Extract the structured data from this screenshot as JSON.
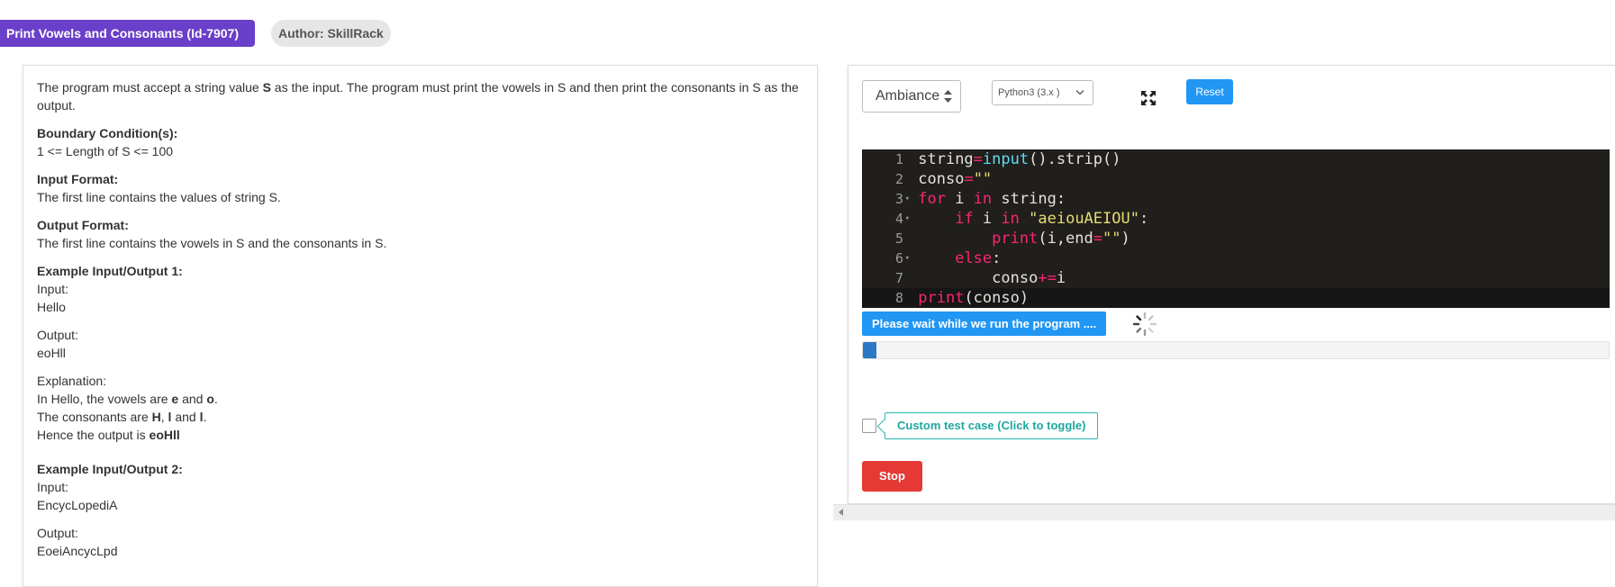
{
  "header": {
    "title": "Print Vowels and Consonants (Id-7907)",
    "author": "Author: SkillRack"
  },
  "problem": {
    "intro_before": "The program must accept a string value ",
    "intro_var": "S",
    "intro_after": " as the input. The program must print the vowels in S and then print the consonants in S as the output.",
    "boundary_heading": "Boundary Condition(s):",
    "boundary_text": "1 <= Length of S <= 100",
    "input_heading": "Input Format:",
    "input_text": "The first line contains the values of string S.",
    "output_heading": "Output Format:",
    "output_text": "The first line contains the vowels in S and the consonants in S.",
    "ex1_heading": "Example Input/Output 1:",
    "ex1_input_label": "Input:",
    "ex1_input": "Hello",
    "ex1_output_label": "Output:",
    "ex1_output": "eoHll",
    "explanation_label": "Explanation:",
    "exp_line1_a": "In Hello, the vowels are ",
    "exp_line1_b": "e",
    "exp_line1_c": " and ",
    "exp_line1_d": "o",
    "exp_line1_e": ".",
    "exp_line2_a": "The consonants are ",
    "exp_line2_b": "H",
    "exp_line2_c": ", ",
    "exp_line2_d": "l",
    "exp_line2_e": " and ",
    "exp_line2_f": "l",
    "exp_line2_g": ".",
    "exp_line3_a": "Hence the output is ",
    "exp_line3_b": "eoHll",
    "ex2_heading": "Example Input/Output 2:",
    "ex2_input_label": "Input:",
    "ex2_input": "EncycLopediA",
    "ex2_output_label": "Output:",
    "ex2_output": "EoeiAncycLpd"
  },
  "editor": {
    "theme": "Ambiance",
    "language": "Python3 (3.x )",
    "reset_label": "Reset",
    "line_numbers": [
      "1",
      "2",
      "3",
      "4",
      "5",
      "6",
      "7",
      "8"
    ],
    "fold_marker": "▾",
    "code": {
      "l1_a": "string",
      "l1_b": "=",
      "l1_c": "input",
      "l1_d": "().strip()",
      "l2_a": "conso",
      "l2_b": "=",
      "l2_c": "\"\"",
      "l3_a": "for",
      "l3_b": " i ",
      "l3_c": "in",
      "l3_d": " string:",
      "l4_indent": "    ",
      "l4_a": "if",
      "l4_b": " i ",
      "l4_c": "in",
      "l4_d": " ",
      "l4_e": "\"aeiouAEIOU\"",
      "l4_f": ":",
      "l5_indent": "        ",
      "l5_a": "print",
      "l5_b": "(i,end",
      "l5_c": "=",
      "l5_d": "\"\"",
      "l5_e": ")",
      "l6_indent": "    ",
      "l6_a": "else",
      "l6_b": ":",
      "l7_indent": "        ",
      "l7_a": "conso",
      "l7_b": "+=",
      "l7_c": "i",
      "l8_a": "print",
      "l8_b": "(conso)"
    },
    "run_status": "Please wait while we run the program ....",
    "progress_fraction": 0.018,
    "custom_test_label": "Custom test case (Click to toggle)",
    "stop_label": "Stop"
  },
  "colors": {
    "title_badge": "#6a3fc9",
    "reset_button": "#2196f3",
    "run_bar": "#2196f3",
    "stop_button": "#e53935",
    "custom_label": "#1fa7a0",
    "editor_bg": "#201f1c",
    "keyword": "#f92672",
    "builtin": "#66d9ef",
    "string": "#e6db74"
  }
}
